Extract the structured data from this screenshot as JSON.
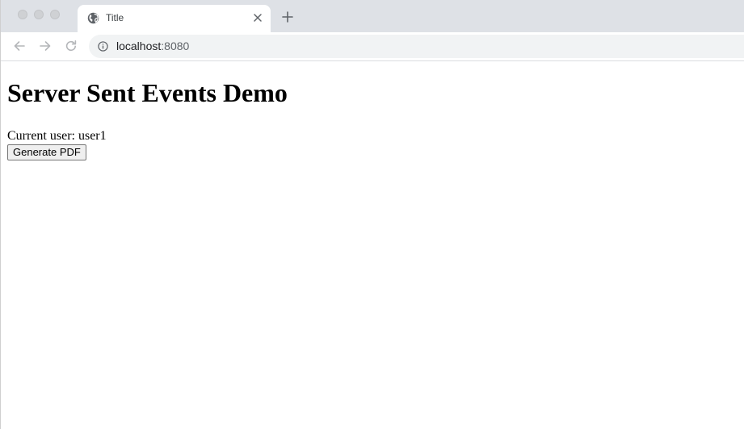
{
  "browser": {
    "tab": {
      "title": "Title",
      "favicon": "globe-icon"
    },
    "address_bar": {
      "host": "localhost",
      "port": ":8080"
    },
    "colors": {
      "tabstrip": "#dee1e6",
      "omnibox": "#f1f3f4"
    }
  },
  "page": {
    "heading": "Server Sent Events Demo",
    "user_line": "Current user: user1",
    "generate_button": "Generate PDF"
  }
}
